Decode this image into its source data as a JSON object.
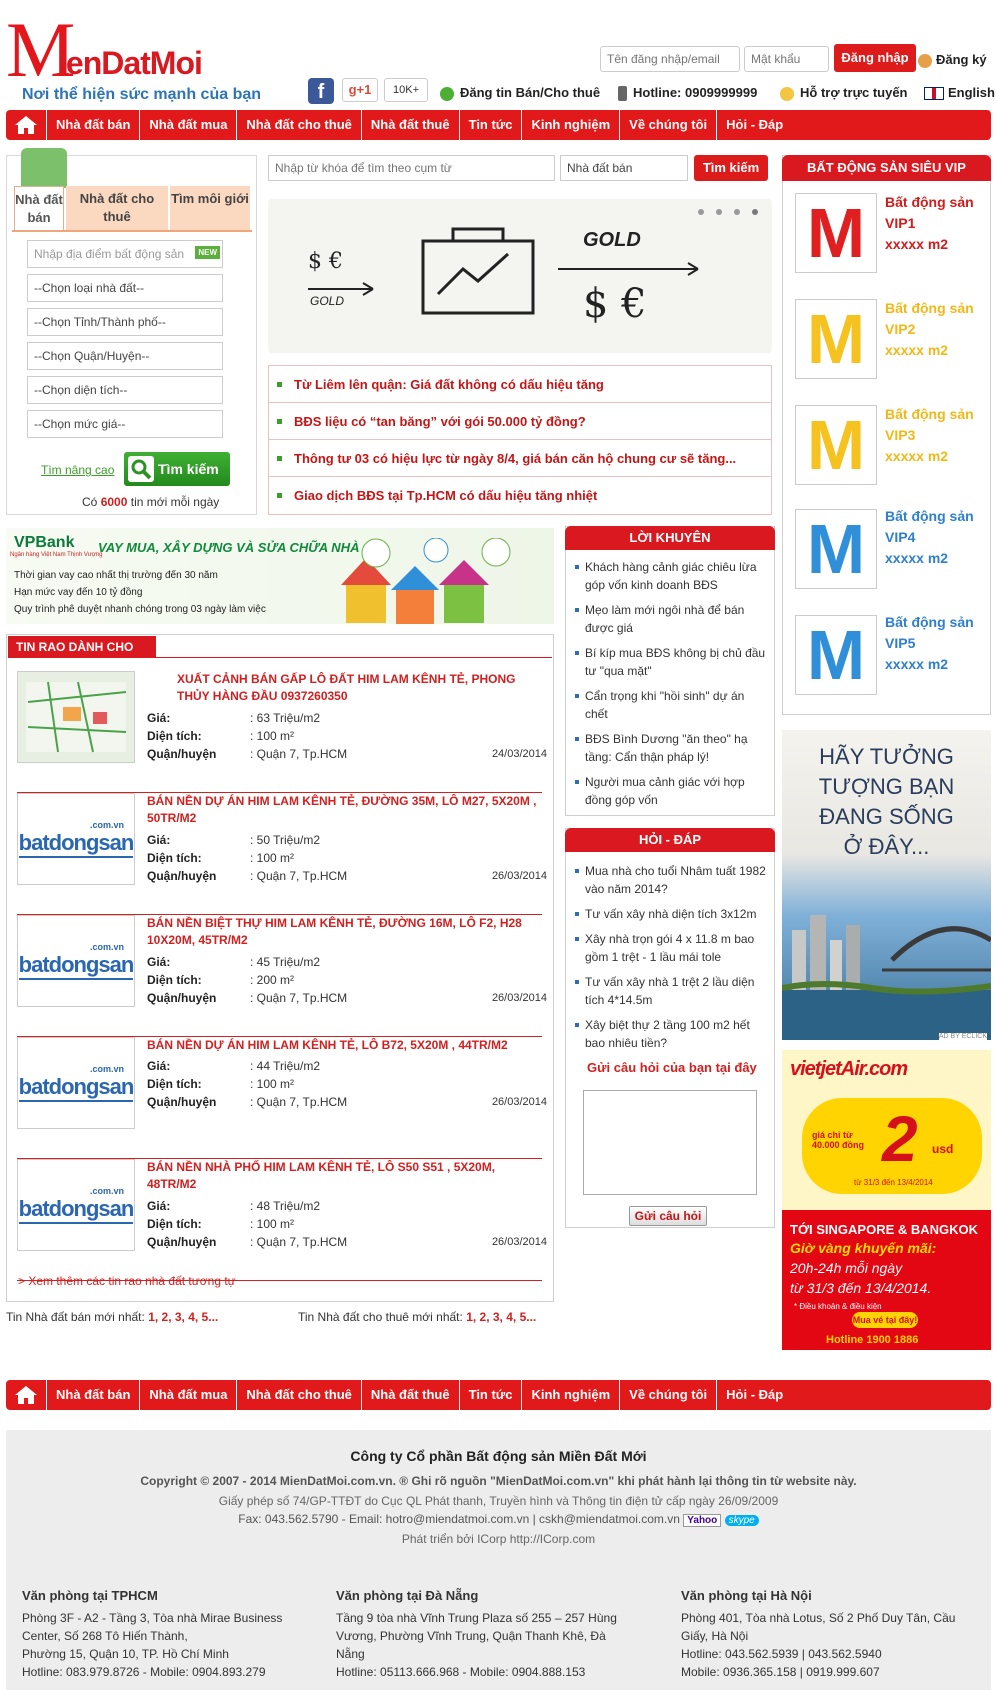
{
  "brand": {
    "logo_big": "M",
    "logo_rest": "ienDatMoi",
    "slogan": "Nơi thể hiện sức mạnh của bạn"
  },
  "login": {
    "user_placeholder": "Tên đăng nhập/email",
    "pass_placeholder": "Mật khẩu",
    "login_label": "Đăng ký",
    "submit_label": "Đăng ký"
  },
  "top": {
    "gplus": "g+1",
    "count": "10K+",
    "post": "Đăng tin Bán/Cho thuê",
    "hotline": "Hotline: 0909999999",
    "support": "Hỗ trợ trực tuyến",
    "lang": "English",
    "submit": "Đăng ký",
    "login_btn": "Đăng ký"
  },
  "header_btn": {
    "login": "Đăng ký",
    "register": "Đăng ký"
  },
  "auth": {
    "button": "Đăng ký",
    "register": "Đăng ký"
  },
  "nav": [
    "Nhà đất bán",
    "Nhà đất mua",
    "Nhà đất cho thuê",
    "Nhà đất thuê",
    "Tin tức",
    "Kinh nghiệm",
    "Về chúng tôi",
    "Hỏi - Đáp"
  ],
  "search_tabs": [
    "Nhà đất bán",
    "Nhà đất cho thuê",
    "Tìm môi giới"
  ],
  "search_form": {
    "location_placeholder": "Nhập địa điểm bất động sản",
    "new_badge": "NEW",
    "selects": [
      "--Chọn loại nhà đất--",
      "--Chọn Tỉnh/Thành phố--",
      "--Chọn Quận/Huyện--",
      "--Chọn diện tích--",
      "--Chọn mức giá--"
    ],
    "advanced": "Tìm nâng cao",
    "search_btn": "Tìm kiếm",
    "count_prefix": "Có",
    "count": "6000",
    "count_suffix": "tin mới mỗi ngày"
  },
  "keyword": {
    "placeholder": "Nhập từ khóa để tìm theo cụm từ",
    "type": "Nhà đất bán",
    "btn": "Tìm kiếm"
  },
  "slider": {
    "left_text": "$ €",
    "left_sub": "GOLD",
    "right_gold": "GOLD",
    "right_sym": "$ €"
  },
  "news": [
    "Từ Liêm lên quận: Giá đất không có dấu hiệu tăng",
    "BĐS liệu có “tan băng” với gói 50.000 tỷ đồng?",
    "Thông tư 03 có hiệu lực từ ngày 8/4, giá bán căn hộ chung cư sẽ tăng...",
    "Giao dịch BĐS tại Tp.HCM có dấu hiệu tăng nhiệt"
  ],
  "vpbank": {
    "brand": "VPBank",
    "tag": "Ngân hàng Việt Nam Thịnh Vượng",
    "headline": "VAY MUA, XÂY DỰNG VÀ SỬA CHỮA NHÀ",
    "l1": "Thời gian vay cao nhất thị trường đến 30 năm",
    "l2": "Hạn mức vay đến 10 tỷ đồng",
    "l3": "Quy trình phê duyệt nhanh chóng trong 03 ngày làm việc"
  },
  "listings_title": "TIN RAO DÀNH CHO BẠN",
  "listing_labels": {
    "price": "Giá:",
    "area": "Diện tích:",
    "district": "Quận/huyện"
  },
  "listings": [
    {
      "title": "XUẤT CẢNH BÁN GẤP LÔ ĐẤT HIM LAM KÊNH TẺ, PHONG THỦY HÀNG ĐẦU 0937260350",
      "price": ": 63 Triệu/m2",
      "area": ": 100 m²",
      "district": ": Quận 7, Tp.HCM",
      "date": "24/03/2014"
    },
    {
      "title": "BÁN NỀN DỰ ÁN HIM LAM KÊNH TẺ, ĐƯỜNG 35M, LÔ M27, 5X20M , 50TR/M2",
      "price": ": 50 Triệu/m2",
      "area": ": 100 m²",
      "district": ": Quận 7, Tp.HCM",
      "date": "26/03/2014"
    },
    {
      "title": "BÁN NỀN BIỆT THỰ HIM LAM KÊNH TẺ, ĐƯỜNG 16M, LÔ F2, H28 10X20M, 45TR/M2",
      "price": ": 45 Triệu/m2",
      "area": ": 200 m²",
      "district": ": Quận 7, Tp.HCM",
      "date": "26/03/2014"
    },
    {
      "title": "BÁN NỀN DỰ ÁN HIM LAM KÊNH TẺ, LÔ B72, 5X20M , 44TR/M2",
      "price": ": 44 Triệu/m2",
      "area": ": 100 m²",
      "district": ": Quận 7, Tp.HCM",
      "date": "26/03/2014"
    },
    {
      "title": "BÁN NỀN NHÀ PHỐ HIM LAM KÊNH TẺ, LÔ S50 S51 , 5X20M, 48TR/M2",
      "price": ": 48 Triệu/m2",
      "area": ": 100 m²",
      "district": ": Quận 7, Tp.HCM",
      "date": "26/03/2014"
    }
  ],
  "bds_logo": {
    "dom": ".com.vn",
    "name": "batdongsan"
  },
  "more_link": "> Xem thêm các tin rao nhà đất tương tự",
  "pager": {
    "sale_label": "Tin Nhà đất bán mới nhất:",
    "rent_label": "Tin Nhà đất cho thuê mới nhất:",
    "pages": "1, 2, 3, 4, 5..."
  },
  "advice": {
    "title": "LỜI KHUYÊN",
    "items": [
      "Khách hàng cảnh giác chiêu lừa góp vốn kinh doanh BĐS",
      "Mẹo làm mới ngôi nhà để bán được giá",
      "Bí kíp mua BĐS không bị chủ đầu tư \"qua mặt\"",
      "Cẩn trọng khi \"hồi sinh\" dự án chết",
      "BĐS Bình Dương \"ăn theo\" hạ tầng: Cẩn thận pháp lý!",
      "Người mua cảnh giác với hợp đồng góp vốn"
    ]
  },
  "qa": {
    "title": "HỎI - ĐÁP",
    "items": [
      "Mua nhà cho tuổi Nhâm tuất 1982 vào năm 2014?",
      "Tư vấn xây nhà diện tích 3x12m",
      "Xây nhà trọn gói 4 x 11.8 m bao gồm 1 trệt - 1 lầu mái tole",
      "Tư vấn xây nhà 1 trệt 2 lầu diện tích 4*14.5m",
      "Xây biệt thự 2 tầng 100 m2 hết bao nhiêu tiền?"
    ],
    "ask": "Gửi câu hỏi của bạn tại đây",
    "submit": "Gửi câu hỏi"
  },
  "vip": {
    "title": "BẤT ĐỘNG SẢN SIÊU VIP",
    "items": [
      {
        "letter": "M",
        "l1": "Bất động sản",
        "l2": "VIP1",
        "l3": "xxxxx m2",
        "color": "#e02020"
      },
      {
        "letter": "M",
        "l1": "Bất động sản",
        "l2": "VIP2",
        "l3": "xxxxx m2",
        "color": "#f6c220"
      },
      {
        "letter": "M",
        "l1": "Bất động sản",
        "l2": "VIP3",
        "l3": "xxxxx m2",
        "color": "#f6c220"
      },
      {
        "letter": "M",
        "l1": "Bất động sản",
        "l2": "VIP4",
        "l3": "xxxxx m2",
        "color": "#2f8fd8"
      },
      {
        "letter": "M",
        "l1": "Bất động sản",
        "l2": "VIP5",
        "l3": "xxxxx m2",
        "color": "#2f8fd8"
      }
    ]
  },
  "ad1": {
    "l1": "HÃY TƯỞNG",
    "l2": "TƯỢNG BẠN",
    "l3": "ĐANG SỐNG",
    "l4": "Ở ĐÂY...",
    "credit": "AD BY ECLICK"
  },
  "ad2": {
    "brand": "vietjetAir.com",
    "price": "giá chỉ từ 40.000 đồng",
    "big": "2",
    "usd": "usd",
    "dates": "từ 31/3 đến 13/4/2014",
    "dest": "TỚI SINGAPORE & BANGKOK",
    "gold": "Giờ vàng khuyến mãi:",
    "hours": "20h-24h mỗi ngày",
    "range": "từ 31/3 đến 13/4/2014.",
    "cond": "* Điều khoản & điều kiện",
    "cta": "Mua vé tại đây!",
    "hotline": "Hotline 1900 1886",
    "credit": "AD BY ECLICK"
  },
  "footer": {
    "company": "Công ty Cổ phần Bất động sản Miền Đất Mới",
    "copyright": "Copyright © 2007 - 2014 MienDatMoi.com.vn. ® Ghi rõ nguồn \"MienDatMoi.com.vn\" khi phát hành lại thông tin từ website này.",
    "license": "Giấy phép số 74/GP-TTĐT do Cục QL Phát thanh, Truyền hình và Thông tin điện tử cấp ngày 26/09/2009",
    "contact": "Fax: 043.562.5790 - Email: hotro@miendatmoi.com.vn | cskh@miendatmoi.com.vn",
    "yahoo": "Yahoo",
    "skype": "skype",
    "dev": "Phát triển bởi ICorp http://ICorp.com",
    "offices": [
      {
        "title": "Văn phòng tại TPHCM",
        "lines": [
          "Phòng 3F - A2 - Tầng 3, Tòa nhà Mirae Business",
          "Center, Số 268 Tô Hiến Thành,",
          "Phường 15, Quận 10, TP. Hồ Chí Minh",
          "Hotline: 083.979.8726 - Mobile: 0904.893.279"
        ]
      },
      {
        "title": "Văn phòng tại Đà Nẵng",
        "lines": [
          "Tầng 9 tòa nhà Vĩnh Trung Plaza số 255 – 257 Hùng",
          "Vương, Phường Vĩnh Trung, Quận Thanh Khê, Đà",
          "Nẵng",
          "Hotline: 05113.666.968 - Mobile: 0904.888.153"
        ]
      },
      {
        "title": "Văn phòng tại Hà Nội",
        "lines": [
          "Phòng 401, Tòa nhà Lotus, Số 2 Phố Duy Tân, Cầu",
          "Giấy, Hà Nội",
          "Hotline: 043.562.5939 | 043.562.5940",
          "Mobile: 0936.365.158 | 0919.999.607"
        ]
      }
    ]
  },
  "colors": {
    "primary": "#e1191a",
    "link": "#d12020",
    "green": "#3a9f26"
  }
}
